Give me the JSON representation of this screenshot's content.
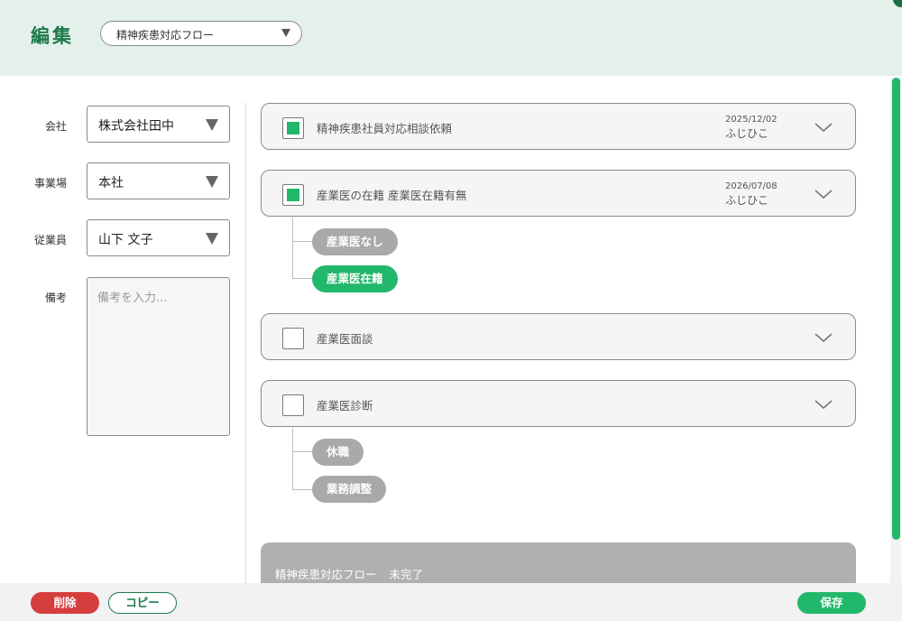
{
  "header": {
    "title": "編集",
    "flow_select": {
      "value": "精神疾患対応フロー",
      "icon": "triangle-down-icon"
    }
  },
  "form": {
    "company": {
      "label": "会社",
      "value": "株式会社田中"
    },
    "site": {
      "label": "事業場",
      "value": "本社"
    },
    "employee": {
      "label": "従業員",
      "value": "山下 文子"
    },
    "memo": {
      "label": "備考",
      "placeholder": "備考を入力..."
    }
  },
  "steps": [
    {
      "title": "精神疾患社員対応相談依頼",
      "checked": true,
      "date": "2025/12/02",
      "user": "ふじひこ"
    },
    {
      "title": "産業医の在籍 産業医在籍有無",
      "checked": true,
      "date": "2026/07/08",
      "user": "ふじひこ",
      "options": [
        {
          "label": "産業医なし",
          "selected": false
        },
        {
          "label": "産業医在籍",
          "selected": true
        }
      ]
    },
    {
      "title": "産業医面談",
      "checked": false
    },
    {
      "title": "産業医診断",
      "checked": false,
      "options": [
        {
          "label": "休職",
          "selected": false
        },
        {
          "label": "業務調整",
          "selected": false
        }
      ]
    }
  ],
  "summary": {
    "flow_name": "精神疾患対応フロー",
    "status": "未完了"
  },
  "footer": {
    "delete_label": "削除",
    "copy_label": "コピー",
    "save_label": "保存"
  },
  "colors": {
    "accent": "#22b86b",
    "brand": "#1e7a4c",
    "danger": "#d63e3e",
    "header_bg": "#e3f1ea"
  }
}
